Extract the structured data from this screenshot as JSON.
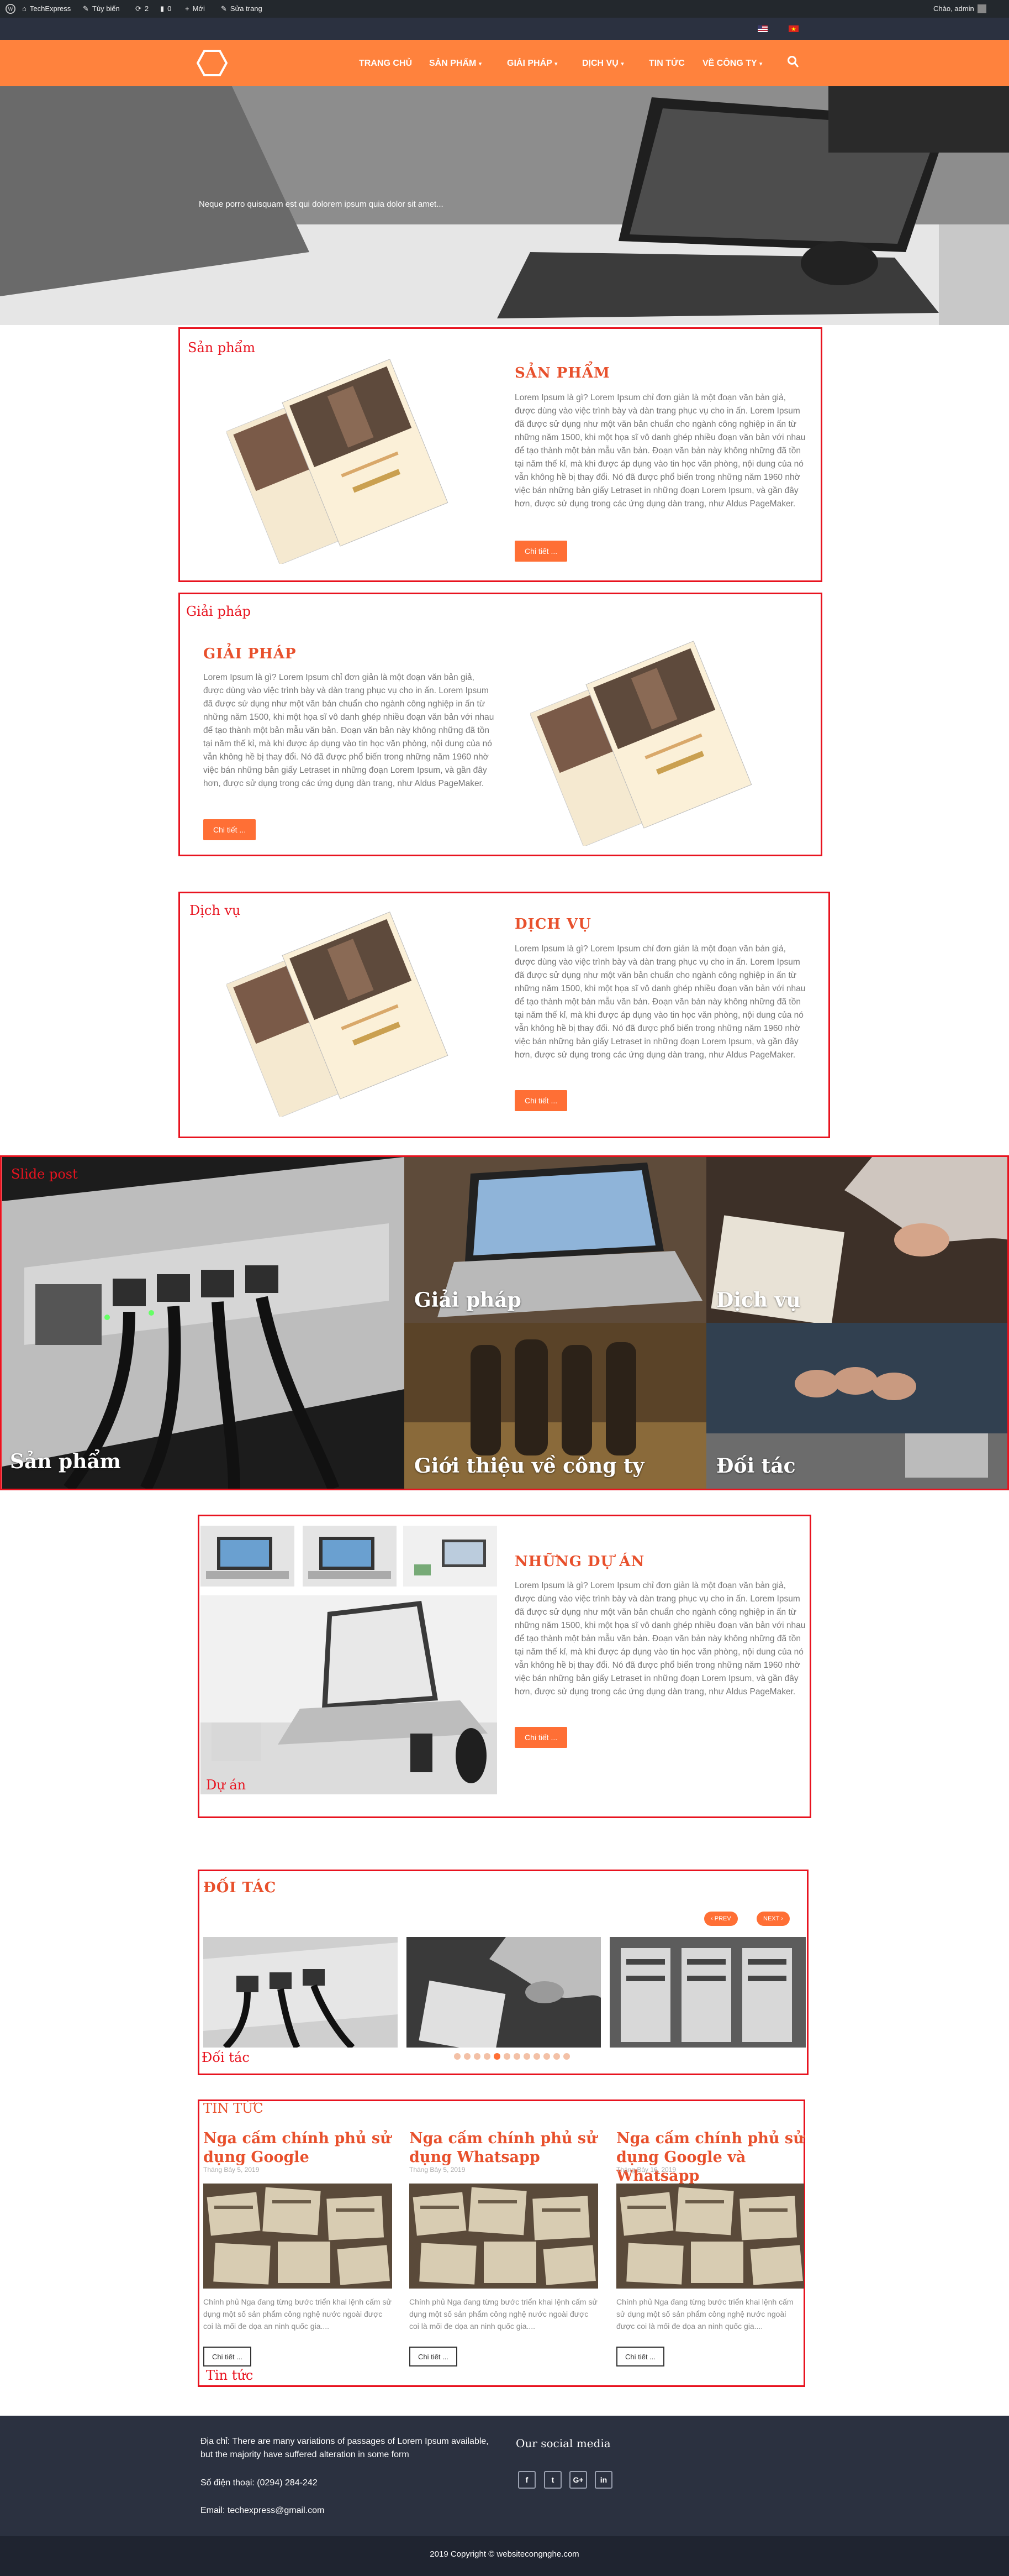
{
  "adminbar": {
    "site": "TechExpress",
    "customize": "Tùy biến",
    "updates": "2",
    "comments": "0",
    "new": "Mới",
    "edit": "Sửa trang",
    "greeting": "Chào, admin"
  },
  "nav": {
    "items": [
      "TRANG CHỦ",
      "SẢN PHẨM",
      "GIẢI PHÁP",
      "DỊCH VỤ",
      "TIN TỨC",
      "VỀ CÔNG TY"
    ]
  },
  "hero": {
    "caption": "Neque porro quisquam est qui dolorem ipsum quia dolor sit amet..."
  },
  "sections": {
    "san_pham": {
      "label": "Sản phẩm",
      "title": "SẢN PHẨM",
      "text": "Lorem Ipsum là gì? Lorem Ipsum chỉ đơn giản là một đoạn văn bản giả, được dùng vào việc trình bày và dàn trang phục vụ cho in ấn. Lorem Ipsum đã được sử dụng như một văn bản chuẩn cho ngành công nghiệp in ấn từ những năm 1500, khi một họa sĩ vô danh ghép nhiều đoạn văn bản với nhau để tạo thành một bản mẫu văn bản. Đoạn văn bản này không những đã tồn tại năm thế kỉ, mà khi được áp dụng vào tin học văn phòng, nội dung của nó vẫn không hề bị thay đổi. Nó đã được phổ biến trong những năm 1960 nhờ việc bán những bản giấy Letraset in những đoạn Lorem Ipsum, và gần đây hơn, được sử dụng trong các ứng dụng dàn trang, như Aldus PageMaker.",
      "button": "Chi tiết ..."
    },
    "giai_phap": {
      "label": "Giải pháp",
      "title": "GIẢI PHÁP",
      "text": "Lorem Ipsum là gì? Lorem Ipsum chỉ đơn giản là một đoạn văn bản giả, được dùng vào việc trình bày và dàn trang phục vụ cho in ấn. Lorem Ipsum đã được sử dụng như một văn bản chuẩn cho ngành công nghiệp in ấn từ những năm 1500, khi một họa sĩ vô danh ghép nhiều đoạn văn bản với nhau để tạo thành một bản mẫu văn bản. Đoạn văn bản này không những đã tồn tại năm thế kỉ, mà khi được áp dụng vào tin học văn phòng, nội dung của nó vẫn không hề bị thay đổi. Nó đã được phổ biến trong những năm 1960 nhờ việc bán những bản giấy Letraset in những đoạn Lorem Ipsum, và gần đây hơn, được sử dụng trong các ứng dụng dàn trang, như Aldus PageMaker.",
      "button": "Chi tiết ..."
    },
    "dich_vu": {
      "label": "Dịch vụ",
      "title": "DỊCH VỤ",
      "text": "Lorem Ipsum là gì? Lorem Ipsum chỉ đơn giản là một đoạn văn bản giả, được dùng vào việc trình bày và dàn trang phục vụ cho in ấn. Lorem Ipsum đã được sử dụng như một văn bản chuẩn cho ngành công nghiệp in ấn từ những năm 1500, khi một họa sĩ vô danh ghép nhiều đoạn văn bản với nhau để tạo thành một bản mẫu văn bản. Đoạn văn bản này không những đã tồn tại năm thế kỉ, mà khi được áp dụng vào tin học văn phòng, nội dung của nó vẫn không hề bị thay đổi. Nó đã được phổ biến trong những năm 1960 nhờ việc bán những bản giấy Letraset in những đoạn Lorem Ipsum, và gần đây hơn, được sử dụng trong các ứng dụng dàn trang, như Aldus PageMaker.",
      "button": "Chi tiết ..."
    }
  },
  "slide_post": {
    "label": "Slide post",
    "tiles": [
      "Sản phẩm",
      "Giải pháp",
      "Dịch vụ",
      "Giới thiệu về công ty",
      "Đối tác"
    ]
  },
  "du_an": {
    "label": "Dự án",
    "title": "NHỮNG DỰ ÁN",
    "text": "Lorem Ipsum là gì? Lorem Ipsum chỉ đơn giản là một đoạn văn bản giả, được dùng vào việc trình bày và dàn trang phục vụ cho in ấn. Lorem Ipsum đã được sử dụng như một văn bản chuẩn cho ngành công nghiệp in ấn từ những năm 1500, khi một họa sĩ vô danh ghép nhiều đoạn văn bản với nhau để tạo thành một bản mẫu văn bản. Đoạn văn bản này không những đã tồn tại năm thế kỉ, mà khi được áp dụng vào tin học văn phòng, nội dung của nó vẫn không hề bị thay đổi. Nó đã được phổ biến trong những năm 1960 nhờ việc bán những bản giấy Letraset in những đoạn Lorem Ipsum, và gần đây hơn, được sử dụng trong các ứng dụng dàn trang, như Aldus PageMaker.",
    "button": "Chi tiết ..."
  },
  "doi_tac": {
    "title": "ĐỐI TÁC",
    "label": "Đối tác",
    "prev": "PREV",
    "next": "NEXT"
  },
  "tin_tuc": {
    "title": "TIN TỨC",
    "label": "Tin tức",
    "posts": [
      {
        "title": "Nga cấm chính phủ sử dụng Google",
        "date": "Tháng Bảy 5, 2019",
        "excerpt": "Chính phủ Nga đang từng bước triển khai lệnh cấm sử dụng một số sản phẩm công nghệ nước ngoài được coi là mối đe dọa an ninh quốc gia....",
        "button": "Chi tiết ..."
      },
      {
        "title": "Nga cấm chính phủ sử dụng Whatsapp",
        "date": "Tháng Bảy 5, 2019",
        "excerpt": "Chính phủ Nga đang từng bước triển khai lệnh cấm sử dụng một số sản phẩm công nghệ nước ngoài được coi là mối đe dọa an ninh quốc gia....",
        "button": "Chi tiết ..."
      },
      {
        "title": "Nga cấm chính phủ sử dụng Google và Whatsapp",
        "date": "Tháng Bảy 16, 2019",
        "excerpt": "Chính phủ Nga đang từng bước triển khai lệnh cấm sử dụng một số sản phẩm công nghệ nước ngoài được coi là mối đe dọa an ninh quốc gia....",
        "button": "Chi tiết ..."
      }
    ]
  },
  "footer": {
    "address": "Địa chỉ: There are many variations of passages of Lorem Ipsum available, but the majority have suffered alteration in some form",
    "phone": "Số điện thoại: (0294) 284-242",
    "email": "Email: techexpress@gmail.com",
    "social_title": "Our social media",
    "social": [
      "f",
      "t",
      "G+",
      "in"
    ],
    "copyright": "2019 Copyright © websitecongnghe.com"
  },
  "colors": {
    "accent": "#ff823d",
    "red_border": "#e8131f",
    "title_orange": "#e8502c",
    "footer_bg": "#2b3140"
  }
}
